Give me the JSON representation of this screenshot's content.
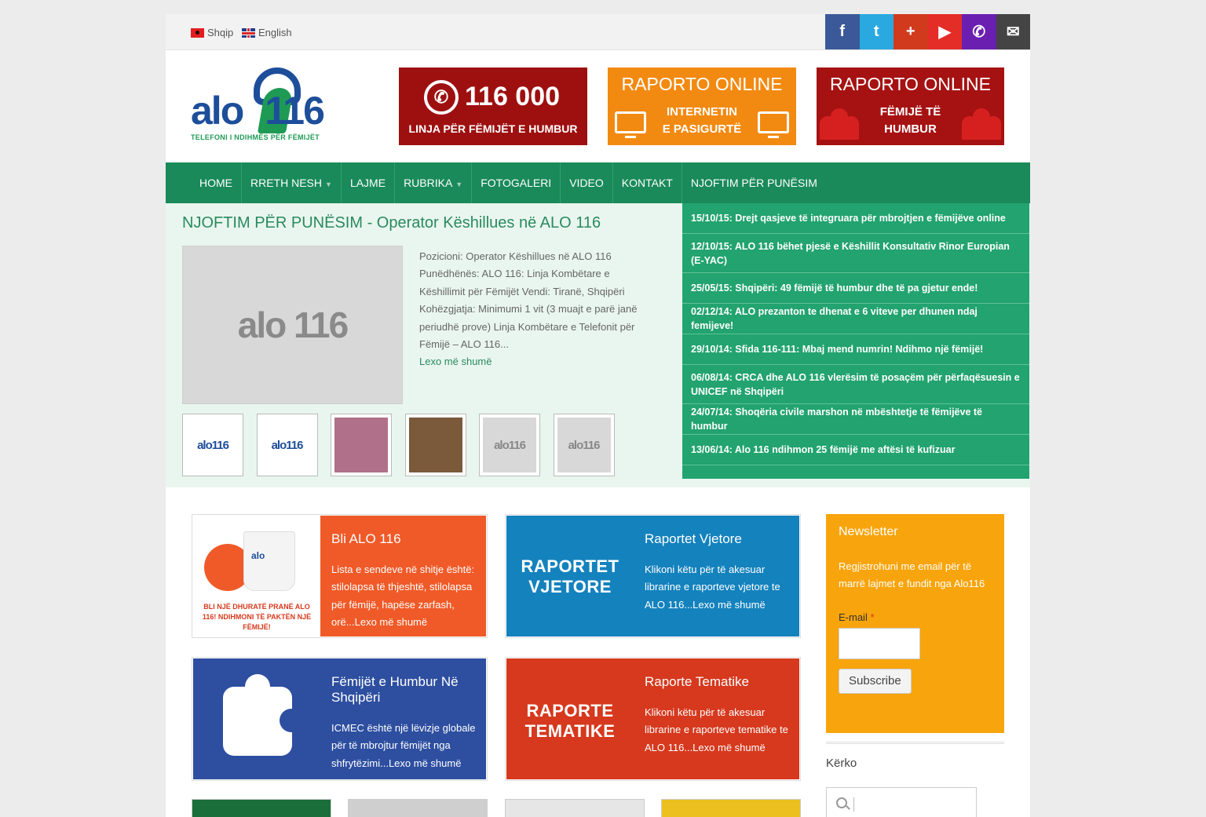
{
  "top_bar": {
    "languages": [
      {
        "label": "Shqip"
      },
      {
        "label": "English"
      }
    ],
    "social": [
      {
        "icon": "facebook-icon",
        "glyph": "f",
        "color": "#3b5998"
      },
      {
        "icon": "twitter-icon",
        "glyph": "t",
        "color": "#2aa9e0"
      },
      {
        "icon": "google-plus-icon",
        "glyph": "+",
        "color": "#d23a1e"
      },
      {
        "icon": "youtube-icon",
        "glyph": "▶",
        "color": "#e52d27"
      },
      {
        "icon": "phone-icon",
        "glyph": "✆",
        "color": "#6a1fb0"
      },
      {
        "icon": "email-icon",
        "glyph": "✉",
        "color": "#444444"
      }
    ]
  },
  "header": {
    "logo_text": "alo",
    "logo_number": "116",
    "logo_tagline": "TELEFONI I NDIHMËS PËR FËMIJËT",
    "banners": {
      "hotline_number": "116 000",
      "hotline_caption": "LINJA PËR FËMIJËT E HUMBUR",
      "report_internet_title": "RAPORTO ONLINE",
      "report_internet_caption_1": "INTERNETIN",
      "report_internet_caption_2": "E PASIGURTË",
      "report_missing_title": "RAPORTO ONLINE",
      "report_missing_caption_1": "FËMIJË TË",
      "report_missing_caption_2": "HUMBUR"
    }
  },
  "nav": {
    "items": [
      {
        "label": "HOME",
        "has_caret": false
      },
      {
        "label": "RRETH NESH",
        "has_caret": true
      },
      {
        "label": "LAJME",
        "has_caret": false
      },
      {
        "label": "RUBRIKA",
        "has_caret": true
      },
      {
        "label": "FOTOGALERI",
        "has_caret": false
      },
      {
        "label": "VIDEO",
        "has_caret": false
      },
      {
        "label": "KONTAKT",
        "has_caret": false
      },
      {
        "label": "NJOFTIM PËR PUNËSIM",
        "has_caret": false
      }
    ]
  },
  "feature": {
    "title": "NJOFTIM PËR PUNËSIM - Operator Këshillues në ALO 116",
    "image_logo": "alo 116",
    "excerpt": "Pozicioni: Operator Këshillues në ALO 116 Punëdhënës: ALO 116: Linja Kombëtare e Këshillimit për Fëmijët Vendi: Tiranë, Shqipëri Kohëzgjatja: Minimumi 1 vit (3 muajt e parë janë periudhë prove) Linja Kombëtare e Telefonit për Fëmijë – ALO 116...",
    "read_more": "Lexo më shumë",
    "thumbnails": [
      "alo116",
      "alo116",
      "",
      "",
      "alo116",
      "alo116"
    ]
  },
  "news": [
    "15/10/15: Drejt qasjeve të integruara për mbrojtjen e fëmijëve online",
    "12/10/15: ALO 116 bëhet pjesë e Këshillit Konsultativ Rinor Europian (E-YAC)",
    "25/05/15: Shqipëri: 49 fëmijë të humbur dhe të pa gjetur ende!",
    "02/12/14: ALO prezanton te dhenat e 6 viteve per dhunen ndaj femijeve!",
    "29/10/14: Sfida 116-111: Mbaj mend numrin! Ndihmo një fëmijë!",
    "06/08/14: CRCA dhe ALO 116 vlerësim të posaçëm për përfaqësuesin e UNICEF në Shqipëri",
    "24/07/14: Shoqëria civile marshon në mbështetje të fëmijëve të humbur",
    "13/06/14: Alo 116 ndihmon 25 fëmijë me aftësi të kufizuar"
  ],
  "cards": [
    {
      "title": "Bli ALO 116",
      "text": "Lista e sendeve në shitje është: stilolapsa të thjeshtë, stilolapsa për fëmijë, hapëse zarfash, orë...Lexo më shumë",
      "color": "#f05a28",
      "pic_text": "BLI NJË DHURATË PRANË ALO 116! NDIHMONI TË PAKTËN NJË FËMIJË!"
    },
    {
      "title": "Raportet Vjetore",
      "text": "Klikoni këtu për të akesuar librarine e raporteve vjetore te ALO 116...Lexo më shumë",
      "color": "#1482bd",
      "pic_text": "RAPORTET VJETORE"
    },
    {
      "title": "Fëmijët e Humbur Në Shqipëri",
      "text": "ICMEC është një lëvizje globale për të mbrojtur fëmijët nga shfrytëzimi...Lexo më shumë",
      "color": "#2e4fa0",
      "pic_text": ""
    },
    {
      "title": "Raporte Tematike",
      "text": "Klikoni këtu për të akesuar librarine e raporteve tematike te ALO 116...Lexo më shumë",
      "color": "#d6391e",
      "pic_text": "RAPORTE TEMATIKE"
    }
  ],
  "sidebar": {
    "newsletter_title": "Newsletter",
    "newsletter_text": "Regjistrohuni me email për të marrë lajmet e fundit nga Alo116",
    "email_label": "E-mail",
    "required_mark": "*",
    "subscribe_label": "Subscribe",
    "search_title": "Kërko"
  }
}
